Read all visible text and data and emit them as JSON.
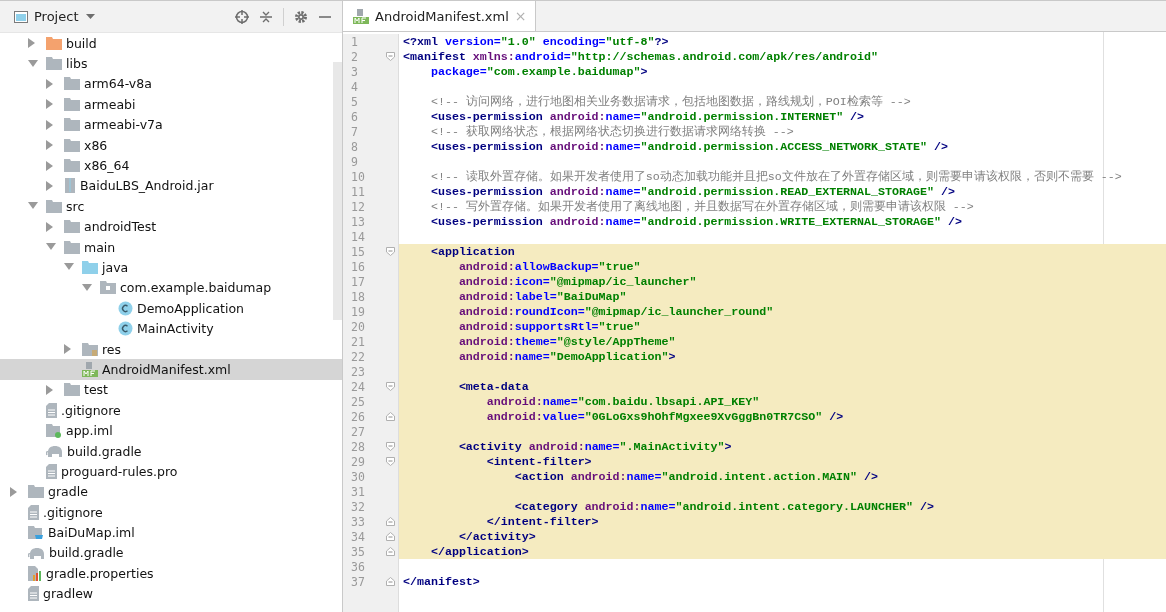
{
  "project_panel": {
    "title": "Project",
    "nested_items": [
      {
        "label": "build",
        "kind": "excluded-folder",
        "expanded": false,
        "selected": false
      },
      {
        "label": "libs",
        "kind": "folder",
        "expanded": true,
        "selected": false,
        "children": [
          {
            "label": "arm64-v8a",
            "kind": "folder",
            "expanded": false,
            "selected": false
          },
          {
            "label": "armeabi",
            "kind": "folder",
            "expanded": false,
            "selected": false
          },
          {
            "label": "armeabi-v7a",
            "kind": "folder",
            "expanded": false,
            "selected": false
          },
          {
            "label": "x86",
            "kind": "folder",
            "expanded": false,
            "selected": false
          },
          {
            "label": "x86_64",
            "kind": "folder",
            "expanded": false,
            "selected": false
          },
          {
            "label": "BaiduLBS_Android.jar",
            "kind": "jar",
            "expanded": false,
            "selected": false
          }
        ]
      },
      {
        "label": "src",
        "kind": "folder",
        "expanded": true,
        "selected": false,
        "children": [
          {
            "label": "androidTest",
            "kind": "folder",
            "expanded": false,
            "selected": false
          },
          {
            "label": "main",
            "kind": "folder",
            "expanded": true,
            "selected": false,
            "children": [
              {
                "label": "java",
                "kind": "source-folder",
                "expanded": true,
                "selected": false,
                "children": [
                  {
                    "label": "com.example.baidumap",
                    "kind": "package",
                    "expanded": true,
                    "selected": false,
                    "children": [
                      {
                        "label": "DemoApplication",
                        "kind": "class",
                        "selected": false
                      },
                      {
                        "label": "MainActivity",
                        "kind": "class",
                        "selected": false
                      }
                    ]
                  }
                ]
              },
              {
                "label": "res",
                "kind": "res-folder",
                "expanded": false,
                "selected": false
              },
              {
                "label": "AndroidManifest.xml",
                "kind": "manifest",
                "selected": true
              }
            ]
          },
          {
            "label": "test",
            "kind": "folder",
            "expanded": false,
            "selected": false
          }
        ]
      },
      {
        "label": ".gitignore",
        "kind": "text-file",
        "selected": false
      },
      {
        "label": "app.iml",
        "kind": "module-file",
        "selected": false
      },
      {
        "label": "build.gradle",
        "kind": "gradle-file",
        "selected": false
      },
      {
        "label": "proguard-rules.pro",
        "kind": "text-file",
        "selected": false
      }
    ],
    "items": [
      {
        "label": "gradle",
        "kind": "folder",
        "expanded": false,
        "selected": false
      },
      {
        "label": ".gitignore",
        "kind": "text-file",
        "selected": false
      },
      {
        "label": "BaiDuMap.iml",
        "kind": "project-file",
        "selected": false
      },
      {
        "label": "build.gradle",
        "kind": "gradle-file",
        "selected": false
      },
      {
        "label": "gradle.properties",
        "kind": "properties-file",
        "selected": false
      },
      {
        "label": "gradlew",
        "kind": "text-file",
        "selected": false
      }
    ]
  },
  "editor": {
    "tabs": [
      {
        "label": "AndroidManifest.xml",
        "close": "×",
        "selected": true
      }
    ],
    "lines": [
      {
        "n": "1",
        "highlighted": false,
        "tokens": [
          {
            "kind": "tag",
            "text": "<?xml "
          },
          {
            "kind": "attr",
            "text": "version="
          },
          {
            "kind": "val",
            "text": "\"1.0\""
          },
          {
            "kind": "attr",
            "text": " encoding="
          },
          {
            "kind": "val",
            "text": "\"utf-8\""
          },
          {
            "kind": "tag",
            "text": "?>"
          }
        ]
      },
      {
        "n": "2",
        "highlighted": false,
        "kind": "opener",
        "tokens": [
          {
            "kind": "tag",
            "text": "<manifest"
          },
          {
            "kind": "ns",
            "text": " xmlns:"
          },
          {
            "kind": "attr",
            "text": "android="
          },
          {
            "kind": "val",
            "text": "\"http://schemas.android.com/apk/res/android\""
          }
        ]
      },
      {
        "n": "3",
        "highlighted": false,
        "tokens": [
          {
            "kind": "attr",
            "text": "    package="
          },
          {
            "kind": "val",
            "text": "\"com.example.baidumap\""
          },
          {
            "kind": "tag",
            "text": ">"
          }
        ]
      },
      {
        "n": "4",
        "highlighted": false
      },
      {
        "n": "5",
        "highlighted": false,
        "tokens": [
          {
            "kind": "com",
            "text": "    <!-- 访问网络，进行地图相关业务数据请求，包括地图数据，路线规划，POI检索等 -->"
          }
        ]
      },
      {
        "n": "6",
        "highlighted": false,
        "tokens": [
          {
            "kind": "tag",
            "text": "    <uses-permission"
          },
          {
            "kind": "ns",
            "text": " android:"
          },
          {
            "kind": "attr",
            "text": "name="
          },
          {
            "kind": "val",
            "text": "\"android.permission.INTERNET\""
          },
          {
            "kind": "tag",
            "text": " />"
          }
        ]
      },
      {
        "n": "7",
        "highlighted": false,
        "tokens": [
          {
            "kind": "com",
            "text": "    <!-- 获取网络状态，根据网络状态切换进行数据请求网络转换 -->"
          }
        ]
      },
      {
        "n": "8",
        "highlighted": false,
        "tokens": [
          {
            "kind": "tag",
            "text": "    <uses-permission"
          },
          {
            "kind": "ns",
            "text": " android:"
          },
          {
            "kind": "attr",
            "text": "name="
          },
          {
            "kind": "val",
            "text": "\"android.permission.ACCESS_NETWORK_STATE\""
          },
          {
            "kind": "tag",
            "text": " />"
          }
        ]
      },
      {
        "n": "9",
        "highlighted": false
      },
      {
        "n": "10",
        "highlighted": false,
        "tokens": [
          {
            "kind": "com",
            "text": "    <!-- 读取外置存储。如果开发者使用了so动态加载功能并且把so文件放在了外置存储区域，则需要申请该权限，否则不需要 -->"
          }
        ]
      },
      {
        "n": "11",
        "highlighted": false,
        "tokens": [
          {
            "kind": "tag",
            "text": "    <uses-permission"
          },
          {
            "kind": "ns",
            "text": " android:"
          },
          {
            "kind": "attr",
            "text": "name="
          },
          {
            "kind": "val",
            "text": "\"android.permission.READ_EXTERNAL_STORAGE\""
          },
          {
            "kind": "tag",
            "text": " />"
          }
        ]
      },
      {
        "n": "12",
        "highlighted": false,
        "tokens": [
          {
            "kind": "com",
            "text": "    <!-- 写外置存储。如果开发者使用了离线地图，并且数据写在外置存储区域，则需要申请该权限 -->"
          }
        ]
      },
      {
        "n": "13",
        "highlighted": false,
        "tokens": [
          {
            "kind": "tag",
            "text": "    <uses-permission"
          },
          {
            "kind": "ns",
            "text": " android:"
          },
          {
            "kind": "attr",
            "text": "name="
          },
          {
            "kind": "val",
            "text": "\"android.permission.WRITE_EXTERNAL_STORAGE\""
          },
          {
            "kind": "tag",
            "text": " />"
          }
        ]
      },
      {
        "n": "14",
        "highlighted": false
      },
      {
        "n": "15",
        "highlighted": true,
        "kind": "opener",
        "tokens": [
          {
            "kind": "tag",
            "text": "    <application"
          }
        ]
      },
      {
        "n": "16",
        "highlighted": true,
        "tokens": [
          {
            "kind": "ns",
            "text": "        android:"
          },
          {
            "kind": "attr",
            "text": "allowBackup="
          },
          {
            "kind": "val",
            "text": "\"true\""
          }
        ]
      },
      {
        "n": "17",
        "highlighted": true,
        "tokens": [
          {
            "kind": "ns",
            "text": "        android:"
          },
          {
            "kind": "attr",
            "text": "icon="
          },
          {
            "kind": "val",
            "text": "\"@mipmap/ic_launcher\""
          }
        ]
      },
      {
        "n": "18",
        "highlighted": true,
        "tokens": [
          {
            "kind": "ns",
            "text": "        android:"
          },
          {
            "kind": "attr",
            "text": "label="
          },
          {
            "kind": "val",
            "text": "\"BaiDuMap\""
          }
        ]
      },
      {
        "n": "19",
        "highlighted": true,
        "tokens": [
          {
            "kind": "ns",
            "text": "        android:"
          },
          {
            "kind": "attr",
            "text": "roundIcon="
          },
          {
            "kind": "val",
            "text": "\"@mipmap/ic_launcher_round\""
          }
        ]
      },
      {
        "n": "20",
        "highlighted": true,
        "tokens": [
          {
            "kind": "ns",
            "text": "        android:"
          },
          {
            "kind": "attr",
            "text": "supportsRtl="
          },
          {
            "kind": "val",
            "text": "\"true\""
          }
        ]
      },
      {
        "n": "21",
        "highlighted": true,
        "tokens": [
          {
            "kind": "ns",
            "text": "        android:"
          },
          {
            "kind": "attr",
            "text": "theme="
          },
          {
            "kind": "val",
            "text": "\"@style/AppTheme\""
          }
        ]
      },
      {
        "n": "22",
        "highlighted": true,
        "tokens": [
          {
            "kind": "ns",
            "text": "        android:"
          },
          {
            "kind": "attr",
            "text": "name="
          },
          {
            "kind": "val",
            "text": "\"DemoApplication\""
          },
          {
            "kind": "tag",
            "text": ">"
          }
        ]
      },
      {
        "n": "23",
        "highlighted": true
      },
      {
        "n": "24",
        "highlighted": true,
        "kind": "opener",
        "tokens": [
          {
            "kind": "tag",
            "text": "        <meta-data"
          }
        ]
      },
      {
        "n": "25",
        "highlighted": true,
        "tokens": [
          {
            "kind": "ns",
            "text": "            android:"
          },
          {
            "kind": "attr",
            "text": "name="
          },
          {
            "kind": "val",
            "text": "\"com.baidu.lbsapi.API_KEY\""
          }
        ]
      },
      {
        "n": "26",
        "highlighted": true,
        "kind": "closer",
        "tokens": [
          {
            "kind": "ns",
            "text": "            android:"
          },
          {
            "kind": "attr",
            "text": "value="
          },
          {
            "kind": "val",
            "text": "\"0GLoGxs9hOhfMgxee9XvGggBn0TR7CSO\""
          },
          {
            "kind": "tag",
            "text": " />"
          }
        ]
      },
      {
        "n": "27",
        "highlighted": true
      },
      {
        "n": "28",
        "highlighted": true,
        "kind": "opener",
        "tokens": [
          {
            "kind": "tag",
            "text": "        <activity"
          },
          {
            "kind": "ns",
            "text": " android:"
          },
          {
            "kind": "attr",
            "text": "name="
          },
          {
            "kind": "val",
            "text": "\".MainActivity\""
          },
          {
            "kind": "tag",
            "text": ">"
          }
        ]
      },
      {
        "n": "29",
        "highlighted": true,
        "kind": "opener",
        "tokens": [
          {
            "kind": "tag",
            "text": "            <intent-filter>"
          }
        ]
      },
      {
        "n": "30",
        "highlighted": true,
        "tokens": [
          {
            "kind": "tag",
            "text": "                <action"
          },
          {
            "kind": "ns",
            "text": " android:"
          },
          {
            "kind": "attr",
            "text": "name="
          },
          {
            "kind": "val",
            "text": "\"android.intent.action.MAIN\""
          },
          {
            "kind": "tag",
            "text": " />"
          }
        ]
      },
      {
        "n": "31",
        "highlighted": true
      },
      {
        "n": "32",
        "highlighted": true,
        "tokens": [
          {
            "kind": "tag",
            "text": "                <category"
          },
          {
            "kind": "ns",
            "text": " android:"
          },
          {
            "kind": "attr",
            "text": "name="
          },
          {
            "kind": "val",
            "text": "\"android.intent.category.LAUNCHER\""
          },
          {
            "kind": "tag",
            "text": " />"
          }
        ]
      },
      {
        "n": "33",
        "highlighted": true,
        "kind": "closer",
        "tokens": [
          {
            "kind": "tag",
            "text": "            </intent-filter>"
          }
        ]
      },
      {
        "n": "34",
        "highlighted": true,
        "kind": "closer",
        "tokens": [
          {
            "kind": "tag",
            "text": "        </activity>"
          }
        ]
      },
      {
        "n": "35",
        "highlighted": true,
        "kind": "closer",
        "tokens": [
          {
            "kind": "tag",
            "text": "    </application>"
          }
        ]
      },
      {
        "n": "36",
        "highlighted": false
      },
      {
        "n": "37",
        "highlighted": false,
        "kind": "closer",
        "tokens": [
          {
            "kind": "tag",
            "text": "</manifest>"
          }
        ]
      }
    ]
  }
}
